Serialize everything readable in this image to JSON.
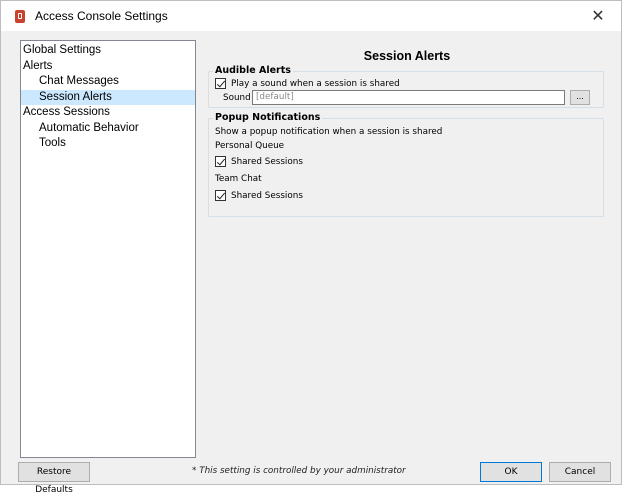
{
  "window": {
    "title": "Access Console Settings",
    "close_glyph": "✕"
  },
  "tree": {
    "items": [
      {
        "label": "Global Settings",
        "level": 0,
        "selected": false
      },
      {
        "label": "Alerts",
        "level": 0,
        "selected": false
      },
      {
        "label": "Chat Messages",
        "level": 1,
        "selected": false
      },
      {
        "label": "Session Alerts",
        "level": 1,
        "selected": true
      },
      {
        "label": "Access Sessions",
        "level": 0,
        "selected": false
      },
      {
        "label": "Automatic Behavior",
        "level": 1,
        "selected": false
      },
      {
        "label": "Tools",
        "level": 1,
        "selected": false
      }
    ]
  },
  "panel": {
    "title": "Session Alerts",
    "audible": {
      "legend": "Audible Alerts",
      "play_sound_label": "Play a sound when a session is shared",
      "play_sound_checked": true,
      "sound_label": "Sound",
      "sound_value": "[default]",
      "browse_label": "..."
    },
    "popup": {
      "legend": "Popup Notifications",
      "description": "Show a popup notification when a session is shared",
      "personal_queue_label": "Personal Queue",
      "personal_shared_label": "Shared Sessions",
      "personal_shared_checked": true,
      "team_chat_label": "Team Chat",
      "team_shared_label": "Shared Sessions",
      "team_shared_checked": true
    }
  },
  "footer": {
    "restore_label": "Restore Defaults",
    "admin_note": "* This setting is controlled by your administrator",
    "ok_label": "OK",
    "cancel_label": "Cancel"
  },
  "colors": {
    "selection": "#cce8ff",
    "ok_border": "#0078d7",
    "app_icon": "#c8422e"
  },
  "icons": {
    "app": "access-console-app-icon",
    "close": "close-icon",
    "checkbox": "checkmark-icon"
  }
}
